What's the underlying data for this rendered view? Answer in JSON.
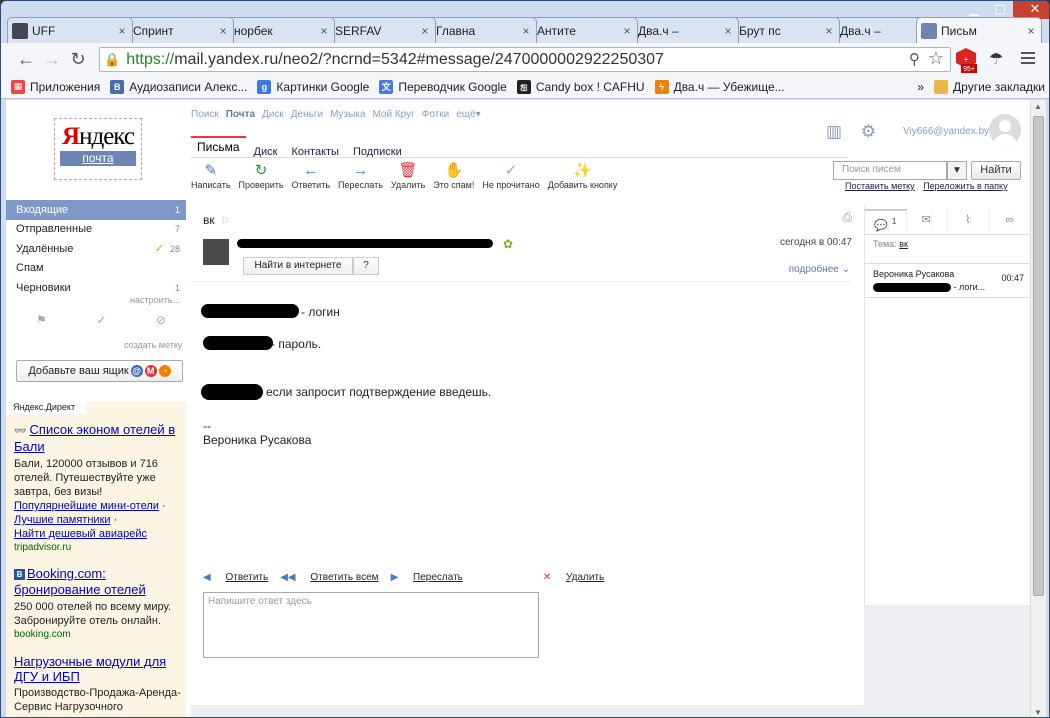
{
  "browser": {
    "tabs": [
      {
        "title": "UFF",
        "icon": "globe-icon",
        "color": "#445"
      },
      {
        "title": "Спринт",
        "icon": "sprint-icon",
        "color": "#c36"
      },
      {
        "title": "норбек",
        "icon": "google-icon",
        "color": "#3b7ae0"
      },
      {
        "title": "SERFAV",
        "icon": "serfav-icon",
        "color": "#2a6a3a"
      },
      {
        "title": "Главна",
        "icon": "page-icon",
        "color": "#999"
      },
      {
        "title": "Антите",
        "icon": "pin-icon",
        "color": "#3a5fa0"
      },
      {
        "title": "Два.ч –",
        "icon": "bolt-icon",
        "color": "#f08000"
      },
      {
        "title": "Брут пс",
        "icon": "chrome-icon",
        "color": "#3b7ae0"
      },
      {
        "title": "Два.ч –",
        "icon": "bolt-icon",
        "color": "#f08000"
      },
      {
        "title": "Письм",
        "icon": "mail-icon",
        "color": "#6e85b4"
      }
    ],
    "url_scheme": "https://",
    "url_rest": "mail.yandex.ru/neo2/?ncrnd=5342#message/2470000002922250307",
    "ext_badge": "95+",
    "bookmarks": [
      {
        "label": "Приложения",
        "icon": "apps-icon",
        "color": "#e44"
      },
      {
        "label": "Аудиозаписи Алекс...",
        "icon": "vk-icon",
        "color": "#4a6ea8",
        "glyph": "В"
      },
      {
        "label": "Картинки Google",
        "icon": "google-icon",
        "color": "#3b7ae0",
        "glyph": "g"
      },
      {
        "label": "Переводчик Google",
        "icon": "translate-icon",
        "color": "#4a7ae0",
        "glyph": "文"
      },
      {
        "label": "Candy box ! CAFHU",
        "icon": "candy-icon",
        "color": "#222",
        "glyph": "ஐ"
      },
      {
        "label": "Два.ч — Убежище...",
        "icon": "bolt-icon",
        "color": "#f08000",
        "glyph": "ϟ"
      }
    ],
    "bookmarks_more": "»",
    "other_bookmarks": "Другие закладки"
  },
  "logo": {
    "brand_red": "Я",
    "brand": "ндекс",
    "sub": "почта"
  },
  "topnav": [
    "Поиск",
    "Почта",
    "Диск",
    "Деньги",
    "Музыка",
    "Мой Круг",
    "Фотки",
    "ещё▾"
  ],
  "topnav_active": "Почта",
  "mail_tabs": [
    "Письма",
    "Диск",
    "Контакты",
    "Подписки"
  ],
  "toolbar": [
    {
      "label": "Написать",
      "icon": "compose-icon",
      "glyph": "✎",
      "color": "#4a7ab8"
    },
    {
      "label": "Проверить",
      "icon": "refresh-icon",
      "glyph": "↻",
      "color": "#2a9a2a"
    },
    {
      "label": "Ответить",
      "icon": "reply-icon",
      "glyph": "←",
      "color": "#4a7ab8"
    },
    {
      "label": "Переслать",
      "icon": "forward-icon",
      "glyph": "→",
      "color": "#4a7ab8"
    },
    {
      "label": "Удалить",
      "icon": "trash-icon",
      "glyph": "🗑",
      "color": "#d33"
    },
    {
      "label": "Это спам!",
      "icon": "spam-icon",
      "glyph": "✋",
      "color": "#f0a000"
    },
    {
      "label": "Не прочитано",
      "icon": "unread-icon",
      "glyph": "✓",
      "color": "#9ab"
    },
    {
      "label": "Добавить кнопку",
      "icon": "magic-icon",
      "glyph": "✨",
      "color": "#e55"
    }
  ],
  "user": "Viy666@yandex.by",
  "search": {
    "placeholder": "Поиск писем",
    "button": "Найти",
    "link1": "Поставить метку",
    "link2": "Переложить в папку"
  },
  "folders": [
    {
      "name": "Входящие",
      "count": "1",
      "active": true
    },
    {
      "name": "Отправленные",
      "count": "7"
    },
    {
      "name": "Удалённые",
      "count": "28"
    },
    {
      "name": "Спам",
      "count": ""
    },
    {
      "name": "Черновики",
      "count": "1"
    }
  ],
  "folders_settings": "настроить...",
  "create_label": "создать метку",
  "add_box": "Добавьте ваш ящик",
  "direct": {
    "header": "Яндекс.Директ",
    "ads": [
      {
        "title": "Список эконом отелей в Бали",
        "text": "Бали, 120000 отзывов и 716 отелей. Путешествуйте уже завтра, без визы!",
        "links": [
          "Популярнейшие мини-отели",
          "Лучшие памятники",
          "Найти дешевый авиарейс"
        ],
        "domain": "tripadvisor.ru"
      },
      {
        "title": "Booking.com: бронирование отелей",
        "text": "250 000 отелей по всему миру. Забронируйте отель онлайн.",
        "domain": "booking.com"
      },
      {
        "title": "Нагрузочные модули для ДГУ и ИБП",
        "text": "Производство-Продажа-Аренда-Сервис Нагрузочного"
      }
    ]
  },
  "message": {
    "subject": "вк",
    "date": "сегодня в 00:47",
    "find_web": "Найти в интернете",
    "q": "?",
    "more": "подробнее",
    "line1": "- логин",
    "line2": "- пароль.",
    "line3": "если запросит подтверждение введешь.",
    "sig_dash": "--",
    "signature": "Вероника Русакова",
    "actions": [
      "Ответить",
      "Ответить всем",
      "Переслать",
      "Удалить"
    ],
    "reply_placeholder": "Напишите ответ здесь"
  },
  "thread": {
    "count": "1",
    "tema_label": "Тема:",
    "tema": "вк",
    "from": "Вероника Русакова",
    "time": "00:47",
    "snippet": "- логи..."
  }
}
